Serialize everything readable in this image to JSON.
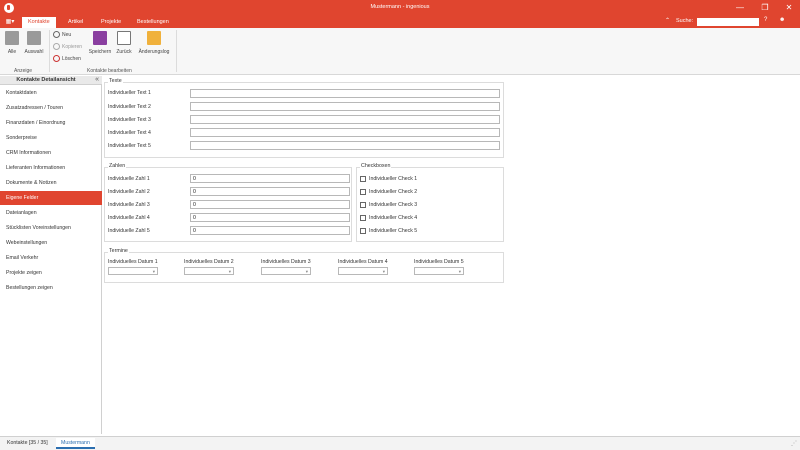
{
  "window": {
    "title": "Mustermann - ingenious",
    "minimize_glyph": "—",
    "maximize_glyph": "❐",
    "close_glyph": "✕"
  },
  "tabs": [
    {
      "label": "Kontakte",
      "active": true
    },
    {
      "label": "Artikel",
      "active": false
    },
    {
      "label": "Projekte",
      "active": false
    },
    {
      "label": "Bestellungen",
      "active": false
    }
  ],
  "search": {
    "label": "Suche:",
    "value": ""
  },
  "ribbon": {
    "anzeige": {
      "alle": "Alle",
      "auswahl": "Auswahl",
      "group_label": "Anzeige"
    },
    "bearbeiten": {
      "neu": "Neu",
      "kopieren": "Kopieren",
      "loeschen": "Löschen",
      "speichern": "Speichern",
      "zurueck": "Zurück",
      "aenderungslog": "Änderungslog",
      "group_label": "Kontakte bearbeiten"
    }
  },
  "sidebar": {
    "title": "Kontakte Detailansicht",
    "collapse_glyph": "«",
    "items": [
      {
        "label": "Kontaktdaten"
      },
      {
        "label": "Zusatzadressen / Touren"
      },
      {
        "label": "Finanzdaten / Einordnung"
      },
      {
        "label": "Sonderpreise"
      },
      {
        "label": "CRM Informationen"
      },
      {
        "label": "Lieferanten Informationen"
      },
      {
        "label": "Dokumente & Notizen"
      },
      {
        "label": "Eigene Felder"
      },
      {
        "label": "Dateianlagen"
      },
      {
        "label": "Stücklisten Voreinstellungen"
      },
      {
        "label": "Webeinstellungen"
      },
      {
        "label": "Email Verkehr"
      },
      {
        "label": "Projekte zeigen"
      },
      {
        "label": "Bestellungen zeigen"
      }
    ]
  },
  "texte": {
    "legend": "Texte",
    "fields": [
      {
        "label": "Individueller Text 1",
        "value": ""
      },
      {
        "label": "Individueller Text 2",
        "value": ""
      },
      {
        "label": "Individueller Text 3",
        "value": ""
      },
      {
        "label": "Individueller Text 4",
        "value": ""
      },
      {
        "label": "Individueller Text 5",
        "value": ""
      }
    ]
  },
  "zahlen": {
    "legend": "Zahlen",
    "fields": [
      {
        "label": "Individuelle Zahl 1",
        "value": "0"
      },
      {
        "label": "Individuelle Zahl 2",
        "value": "0"
      },
      {
        "label": "Individuelle Zahl 3",
        "value": "0"
      },
      {
        "label": "Individuelle Zahl 4",
        "value": "0"
      },
      {
        "label": "Individuelle Zahl 5",
        "value": "0"
      }
    ]
  },
  "checkboxen": {
    "legend": "Checkboxen",
    "fields": [
      {
        "label": "Individueller Check 1",
        "checked": false
      },
      {
        "label": "Individueller Check 2",
        "checked": false
      },
      {
        "label": "Individueller Check 3",
        "checked": false
      },
      {
        "label": "Individueller Check 4",
        "checked": false
      },
      {
        "label": "Individueller Check 5",
        "checked": false
      }
    ]
  },
  "termine": {
    "legend": "Termine",
    "fields": [
      {
        "label": "Individuelles Datum 1",
        "value": ""
      },
      {
        "label": "Individuelles Datum 2",
        "value": ""
      },
      {
        "label": "Individuelles Datum 3",
        "value": ""
      },
      {
        "label": "Individuelles Datum 4",
        "value": ""
      },
      {
        "label": "Individuelles Datum 5",
        "value": ""
      }
    ]
  },
  "statusbar": {
    "tabs": [
      {
        "label": "Kontakte [35 / 35]",
        "active": false
      },
      {
        "label": "Mustermann",
        "active": true
      }
    ]
  },
  "colors": {
    "accent": "#e0452f",
    "active_tab_text": "#2c6fb0"
  }
}
